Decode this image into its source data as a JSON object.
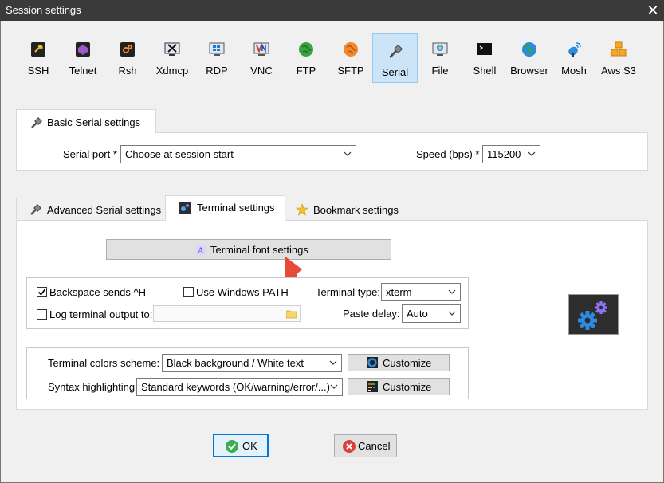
{
  "window": {
    "title": "Session settings",
    "close_glyph": "✕"
  },
  "session_types": [
    {
      "label": "SSH",
      "icon": "ssh-icon"
    },
    {
      "label": "Telnet",
      "icon": "telnet-icon"
    },
    {
      "label": "Rsh",
      "icon": "rsh-icon"
    },
    {
      "label": "Xdmcp",
      "icon": "xdmcp-icon"
    },
    {
      "label": "RDP",
      "icon": "rdp-icon"
    },
    {
      "label": "VNC",
      "icon": "vnc-icon"
    },
    {
      "label": "FTP",
      "icon": "ftp-icon"
    },
    {
      "label": "SFTP",
      "icon": "sftp-icon"
    },
    {
      "label": "Serial",
      "icon": "serial-icon",
      "selected": true
    },
    {
      "label": "File",
      "icon": "file-icon"
    },
    {
      "label": "Shell",
      "icon": "shell-icon"
    },
    {
      "label": "Browser",
      "icon": "browser-icon"
    },
    {
      "label": "Mosh",
      "icon": "mosh-icon"
    },
    {
      "label": "Aws S3",
      "icon": "aws-s3-icon"
    }
  ],
  "basic": {
    "tab_label": "Basic Serial settings",
    "serial_port_label": "Serial port *",
    "serial_port_value": "Choose at session start",
    "speed_label": "Speed (bps) *",
    "speed_value": "115200"
  },
  "tabs": {
    "advanced": "Advanced Serial settings",
    "terminal": "Terminal settings",
    "bookmark": "Bookmark settings"
  },
  "terminal": {
    "font_button": "Terminal font settings",
    "backspace_label": "Backspace sends ^H",
    "backspace_checked": true,
    "windows_path_label": "Use Windows PATH",
    "windows_path_checked": false,
    "terminal_type_label": "Terminal type:",
    "terminal_type_value": "xterm",
    "log_output_label": "Log terminal output to:",
    "log_output_checked": false,
    "log_output_value": "",
    "paste_delay_label": "Paste delay:",
    "paste_delay_value": "Auto",
    "colors_label": "Terminal colors scheme:",
    "colors_value": "Black background / White text",
    "syntax_label": "Syntax highlighting:",
    "syntax_value": "Standard keywords (OK/warning/error/...)",
    "customize_label": "Customize"
  },
  "footer": {
    "ok_label": "OK",
    "cancel_label": "Cancel"
  },
  "colors": {
    "accent": "#cce4f7",
    "arrow": "#e84a3a",
    "ok_green": "#3bae4f",
    "cancel_red": "#d9403a"
  }
}
